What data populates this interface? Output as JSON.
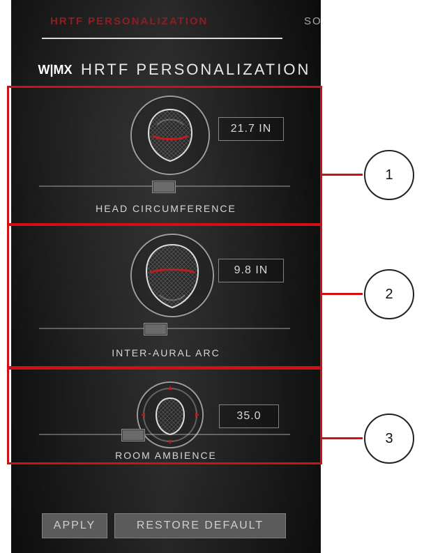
{
  "tabs": {
    "active": "HRTF PERSONALIZATION",
    "second": "SO"
  },
  "brand": {
    "mark": "W|MX",
    "title": "HRTF PERSONALIZATION"
  },
  "sections": [
    {
      "value": "21.7 IN",
      "label": "HEAD CIRCUMFERENCE",
      "slider_value": 0.45
    },
    {
      "value": "9.8 IN",
      "label": "INTER-AURAL ARC",
      "slider_value": 0.42
    },
    {
      "value": "35.0",
      "label": "ROOM AMBIENCE",
      "slider_value": 0.32
    }
  ],
  "buttons": {
    "apply": "APPLY",
    "restore": "RESTORE DEFAULT"
  },
  "callouts": [
    "1",
    "2",
    "3"
  ],
  "colors": {
    "accent_red": "#d10f14",
    "active_tab": "#8d1e24",
    "panel": "#1b1b1b"
  },
  "icons": {
    "head_front": "head-front-icon",
    "head_back": "head-back-icon",
    "head_top": "head-top-icon"
  }
}
